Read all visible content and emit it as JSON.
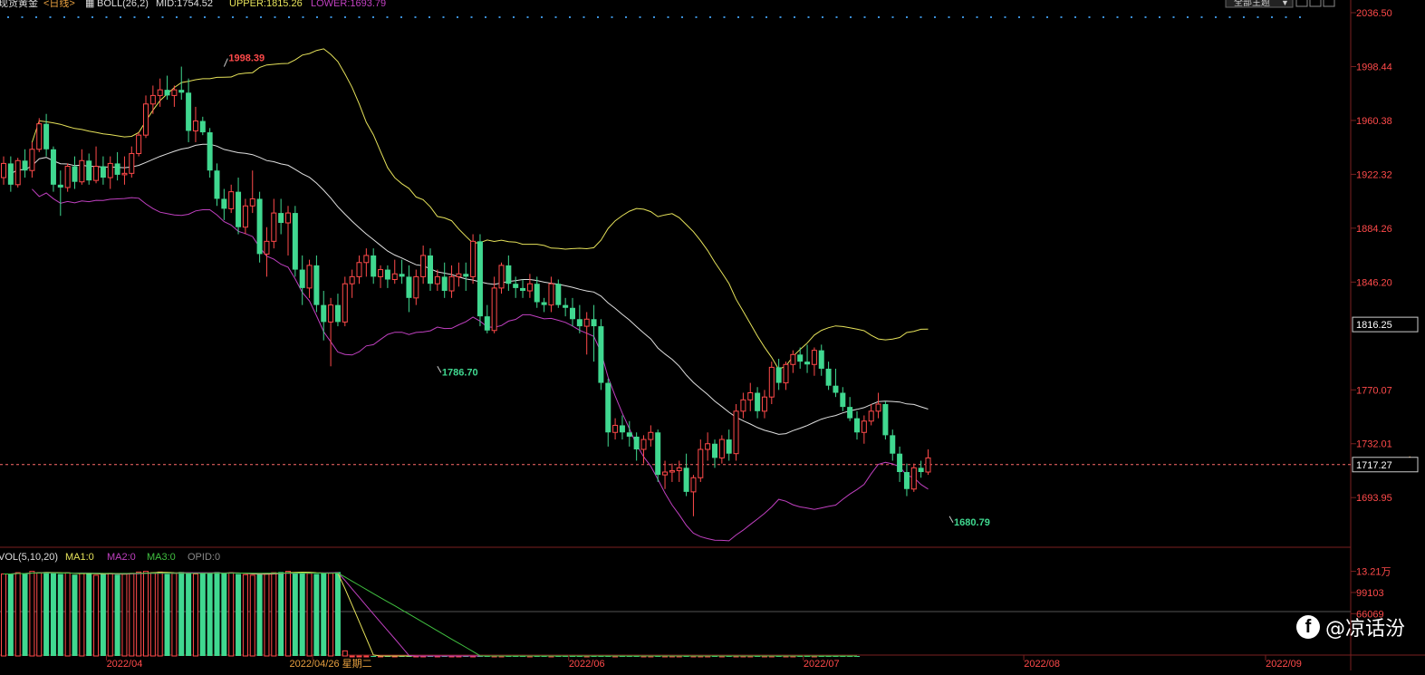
{
  "header": {
    "instrument": "现货黄金",
    "period": "<日线>",
    "indicator": "BOLL(26,2)",
    "mid": "MID:1754.52",
    "upper": "UPPER:1815.26",
    "lower": "LOWER:1693.79",
    "dropdown": "全部主题",
    "colors": {
      "instrument": "#dddddd",
      "period": "#e8a040",
      "mid": "#e0e0e0",
      "upper": "#e6e25a",
      "lower": "#c040c0"
    }
  },
  "vol_header": {
    "name": "VOL(5,10,20)",
    "ma1": "MA1:0",
    "ma2": "MA2:0",
    "ma3": "MA3:0",
    "opid": "OPID:0",
    "colors": {
      "name": "#dddddd",
      "ma1": "#e6e25a",
      "ma2": "#c040c0",
      "ma3": "#40c040",
      "opid": "#888888"
    }
  },
  "watermark": {
    "icon": "facebook-icon",
    "text": "@凉话汾"
  },
  "chart_data": {
    "type": "candlestick",
    "price_axis": {
      "ylim": [
        1680.0,
        2036.5
      ],
      "ticks": [
        {
          "value": 2036.5,
          "label": "2036.50"
        },
        {
          "value": 1998.44,
          "label": "1998.44"
        },
        {
          "value": 1960.38,
          "label": "1960.38"
        },
        {
          "value": 1922.32,
          "label": "1922.32"
        },
        {
          "value": 1884.26,
          "label": "1884.26"
        },
        {
          "value": 1846.2,
          "label": "1846.20"
        },
        {
          "value": 1770.07,
          "label": "1770.07"
        },
        {
          "value": 1732.01,
          "label": "1732.01"
        },
        {
          "value": 1693.95,
          "label": "1693.95"
        }
      ],
      "boxed_labels": [
        {
          "value": 1816.25,
          "label": "1816.25"
        },
        {
          "value": 1717.27,
          "label": "1717.27"
        }
      ],
      "current_price": 1717.27
    },
    "annotations": [
      {
        "label": "1998.39",
        "value": 1998.39,
        "index": 31,
        "color": "#ff4a4a"
      },
      {
        "label": "1786.70",
        "value": 1786.7,
        "index": 61,
        "color": "#40d890"
      },
      {
        "label": "1680.79",
        "value": 1680.79,
        "index": 133,
        "color": "#40d890"
      }
    ],
    "x_labels": [
      {
        "label": "2022/04",
        "index": 17
      },
      {
        "label": "2022/04/26 星期二",
        "index": 46,
        "highlight": true
      },
      {
        "label": "2022/06",
        "index": 82
      },
      {
        "label": "2022/07",
        "index": 115
      },
      {
        "label": "2022/08",
        "index": 146
      },
      {
        "label": "2022/09",
        "index": 180
      }
    ],
    "volume_axis": {
      "ticks": [
        {
          "value": 132100,
          "label": "13.21万"
        },
        {
          "value": 99103,
          "label": "99103"
        },
        {
          "value": 66069,
          "label": "66069"
        }
      ],
      "ylim": [
        0,
        140000
      ]
    },
    "ohlc": [
      [
        1920,
        1935,
        1915,
        1930
      ],
      [
        1930,
        1935,
        1910,
        1915
      ],
      [
        1915,
        1934,
        1913,
        1932
      ],
      [
        1932,
        1940,
        1920,
        1925
      ],
      [
        1925,
        1945,
        1920,
        1940
      ],
      [
        1940,
        1962,
        1938,
        1958
      ],
      [
        1958,
        1965,
        1935,
        1940
      ],
      [
        1940,
        1942,
        1910,
        1915
      ],
      [
        1915,
        1925,
        1893,
        1913
      ],
      [
        1913,
        1930,
        1910,
        1928
      ],
      [
        1928,
        1935,
        1912,
        1917
      ],
      [
        1917,
        1940,
        1915,
        1932
      ],
      [
        1932,
        1937,
        1915,
        1918
      ],
      [
        1918,
        1942,
        1916,
        1928
      ],
      [
        1928,
        1935,
        1915,
        1920
      ],
      [
        1920,
        1935,
        1912,
        1930
      ],
      [
        1930,
        1938,
        1918,
        1922
      ],
      [
        1922,
        1935,
        1915,
        1923
      ],
      [
        1923,
        1942,
        1920,
        1937
      ],
      [
        1937,
        1952,
        1935,
        1950
      ],
      [
        1950,
        1978,
        1948,
        1972
      ],
      [
        1972,
        1985,
        1965,
        1978
      ],
      [
        1978,
        1990,
        1970,
        1982
      ],
      [
        1982,
        1992,
        1975,
        1978
      ],
      [
        1978,
        1985,
        1970,
        1982
      ],
      [
        1982,
        1998.39,
        1975,
        1980
      ],
      [
        1980,
        1990,
        1945,
        1953
      ],
      [
        1953,
        1970,
        1945,
        1960
      ],
      [
        1960,
        1963,
        1950,
        1952
      ],
      [
        1952,
        1955,
        1920,
        1925
      ],
      [
        1925,
        1930,
        1900,
        1905
      ],
      [
        1905,
        1912,
        1890,
        1898
      ],
      [
        1898,
        1915,
        1895,
        1910
      ],
      [
        1910,
        1920,
        1880,
        1885
      ],
      [
        1885,
        1905,
        1880,
        1900
      ],
      [
        1900,
        1925,
        1895,
        1905
      ],
      [
        1905,
        1910,
        1860,
        1866
      ],
      [
        1866,
        1885,
        1850,
        1875
      ],
      [
        1875,
        1905,
        1870,
        1895
      ],
      [
        1895,
        1905,
        1880,
        1888
      ],
      [
        1888,
        1900,
        1865,
        1895
      ],
      [
        1895,
        1900,
        1850,
        1855
      ],
      [
        1855,
        1865,
        1830,
        1842
      ],
      [
        1842,
        1862,
        1835,
        1858
      ],
      [
        1858,
        1865,
        1825,
        1830
      ],
      [
        1830,
        1840,
        1805,
        1818
      ],
      [
        1818,
        1835,
        1786.7,
        1830
      ],
      [
        1830,
        1838,
        1815,
        1818
      ],
      [
        1818,
        1850,
        1815,
        1845
      ],
      [
        1845,
        1855,
        1835,
        1850
      ],
      [
        1850,
        1865,
        1845,
        1860
      ],
      [
        1860,
        1870,
        1850,
        1865
      ],
      [
        1865,
        1870,
        1845,
        1850
      ],
      [
        1850,
        1858,
        1842,
        1855
      ],
      [
        1855,
        1858,
        1842,
        1848
      ],
      [
        1848,
        1862,
        1845,
        1852
      ],
      [
        1852,
        1862,
        1845,
        1850
      ],
      [
        1850,
        1858,
        1825,
        1835
      ],
      [
        1835,
        1855,
        1830,
        1850
      ],
      [
        1850,
        1872,
        1845,
        1865
      ],
      [
        1865,
        1870,
        1840,
        1845
      ],
      [
        1845,
        1855,
        1840,
        1850
      ],
      [
        1850,
        1860,
        1835,
        1840
      ],
      [
        1840,
        1858,
        1835,
        1850
      ],
      [
        1850,
        1860,
        1843,
        1852
      ],
      [
        1852,
        1860,
        1840,
        1850
      ],
      [
        1850,
        1880,
        1845,
        1875
      ],
      [
        1875,
        1880,
        1815,
        1822
      ],
      [
        1822,
        1830,
        1810,
        1812
      ],
      [
        1812,
        1850,
        1810,
        1842
      ],
      [
        1842,
        1860,
        1838,
        1858
      ],
      [
        1858,
        1865,
        1840,
        1845
      ],
      [
        1845,
        1850,
        1835,
        1842
      ],
      [
        1842,
        1848,
        1835,
        1840
      ],
      [
        1840,
        1852,
        1835,
        1845
      ],
      [
        1845,
        1850,
        1828,
        1832
      ],
      [
        1832,
        1835,
        1825,
        1830
      ],
      [
        1830,
        1850,
        1825,
        1845
      ],
      [
        1845,
        1848,
        1828,
        1830
      ],
      [
        1830,
        1835,
        1822,
        1828
      ],
      [
        1828,
        1835,
        1815,
        1820
      ],
      [
        1820,
        1830,
        1810,
        1815
      ],
      [
        1815,
        1825,
        1795,
        1820
      ],
      [
        1820,
        1830,
        1790,
        1815
      ],
      [
        1815,
        1820,
        1770,
        1775
      ],
      [
        1775,
        1778,
        1730,
        1740
      ],
      [
        1740,
        1750,
        1735,
        1745
      ],
      [
        1745,
        1752,
        1735,
        1740
      ],
      [
        1740,
        1748,
        1730,
        1737
      ],
      [
        1737,
        1740,
        1720,
        1728
      ],
      [
        1728,
        1738,
        1718,
        1735
      ],
      [
        1735,
        1745,
        1730,
        1740
      ],
      [
        1740,
        1742,
        1705,
        1710
      ],
      [
        1710,
        1720,
        1700,
        1712
      ],
      [
        1712,
        1718,
        1705,
        1713
      ],
      [
        1713,
        1720,
        1705,
        1715
      ],
      [
        1715,
        1725,
        1695,
        1698
      ],
      [
        1698,
        1710,
        1680.79,
        1708
      ],
      [
        1708,
        1735,
        1705,
        1728
      ],
      [
        1728,
        1740,
        1720,
        1732
      ],
      [
        1732,
        1735,
        1715,
        1722
      ],
      [
        1722,
        1738,
        1718,
        1735
      ],
      [
        1735,
        1742,
        1720,
        1725
      ],
      [
        1725,
        1760,
        1720,
        1755
      ],
      [
        1755,
        1768,
        1750,
        1763
      ],
      [
        1763,
        1775,
        1755,
        1768
      ],
      [
        1768,
        1772,
        1750,
        1755
      ],
      [
        1755,
        1770,
        1750,
        1765
      ],
      [
        1765,
        1790,
        1760,
        1786
      ],
      [
        1786,
        1792,
        1770,
        1775
      ],
      [
        1775,
        1790,
        1770,
        1788
      ],
      [
        1788,
        1798,
        1782,
        1795
      ],
      [
        1795,
        1800,
        1785,
        1790
      ],
      [
        1790,
        1802,
        1782,
        1788
      ],
      [
        1788,
        1800,
        1780,
        1798
      ],
      [
        1798,
        1802,
        1780,
        1785
      ],
      [
        1785,
        1790,
        1770,
        1773
      ],
      [
        1773,
        1785,
        1765,
        1768
      ],
      [
        1768,
        1772,
        1755,
        1758
      ],
      [
        1758,
        1765,
        1748,
        1750
      ],
      [
        1750,
        1755,
        1735,
        1740
      ],
      [
        1740,
        1752,
        1732,
        1748
      ],
      [
        1748,
        1760,
        1745,
        1755
      ],
      [
        1755,
        1768,
        1750,
        1760
      ],
      [
        1760,
        1762,
        1735,
        1738
      ],
      [
        1738,
        1742,
        1720,
        1725
      ],
      [
        1725,
        1730,
        1705,
        1712
      ],
      [
        1712,
        1718,
        1695,
        1700
      ],
      [
        1700,
        1718,
        1698,
        1715
      ],
      [
        1715,
        1720,
        1708,
        1712
      ],
      [
        1712,
        1728,
        1710,
        1722
      ]
    ],
    "volume": [
      128000,
      128000,
      130000,
      129000,
      132000,
      130000,
      131000,
      129000,
      128000,
      130000,
      127000,
      129000,
      130000,
      126000,
      128000,
      129000,
      127000,
      128000,
      129000,
      131000,
      132000,
      130000,
      131000,
      128000,
      129000,
      131000,
      130000,
      128000,
      129000,
      130000,
      131000,
      129000,
      130000,
      128000,
      127000,
      126000,
      128000,
      129000,
      130000,
      131000,
      132000,
      130000,
      131000,
      129000,
      128000,
      130000,
      129000,
      131000,
      8000,
      0,
      0,
      0,
      0,
      0,
      0,
      0,
      0,
      0,
      0,
      0,
      0,
      0,
      0,
      0,
      0,
      0,
      0,
      0,
      0,
      0,
      0,
      0,
      0,
      0,
      0,
      0,
      0,
      0,
      0,
      0,
      0,
      0,
      0,
      0,
      0,
      0,
      0,
      0,
      0,
      0,
      0,
      0,
      0,
      0,
      0,
      0,
      0,
      0,
      0,
      0,
      0,
      0,
      0,
      0,
      0,
      0,
      0,
      0,
      0,
      0,
      0,
      0,
      0,
      0,
      0,
      0,
      0,
      0,
      0,
      0,
      0
    ],
    "colors": {
      "up": "#ff4a4a",
      "down": "#40d890",
      "mid": "#e0e0e0",
      "upper": "#e6e25a",
      "lower": "#c040c0",
      "grid": "#7a1f1f",
      "axis_text": "#ff4a4a"
    }
  }
}
